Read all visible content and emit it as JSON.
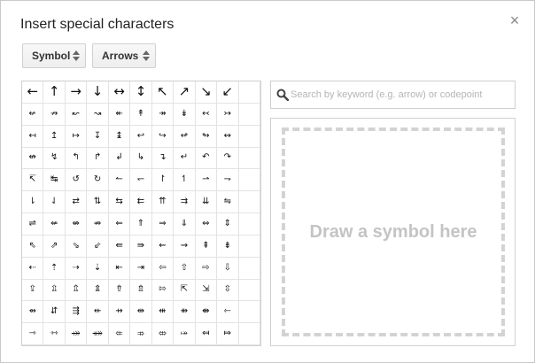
{
  "dialog": {
    "title": "Insert special characters",
    "close_label": "×"
  },
  "selectors": {
    "category": "Symbol",
    "subcategory": "Arrows"
  },
  "search": {
    "placeholder": "Search by keyword (e.g. arrow) or codepoint",
    "value": ""
  },
  "draw": {
    "label": "Draw a symbol here"
  },
  "icons": {
    "close": "close-icon",
    "search": "search-icon",
    "select_arrows": "updown-chevron-icon"
  },
  "grid": {
    "rows": [
      [
        "←",
        "↑",
        "→",
        "↓",
        "↔",
        "↕",
        "↖",
        "↗",
        "↘",
        "↙"
      ],
      [
        "↚",
        "↛",
        "↜",
        "↝",
        "↞",
        "↟",
        "↠",
        "↡",
        "↢",
        "↣"
      ],
      [
        "↤",
        "↥",
        "↦",
        "↧",
        "↨",
        "↩",
        "↪",
        "↫",
        "↬",
        "↭"
      ],
      [
        "↮",
        "↯",
        "↰",
        "↱",
        "↲",
        "↳",
        "↴",
        "↵",
        "↶",
        "↷"
      ],
      [
        "↸",
        "↹",
        "↺",
        "↻",
        "↼",
        "↽",
        "↾",
        "↿",
        "⇀",
        "⇁"
      ],
      [
        "⇂",
        "⇃",
        "⇄",
        "⇅",
        "⇆",
        "⇇",
        "⇈",
        "⇉",
        "⇊",
        "⇋"
      ],
      [
        "⇌",
        "⇍",
        "⇎",
        "⇏",
        "⇐",
        "⇑",
        "⇒",
        "⇓",
        "⇔",
        "⇕"
      ],
      [
        "⇖",
        "⇗",
        "⇘",
        "⇙",
        "⇚",
        "⇛",
        "⇜",
        "⇝",
        "⇞",
        "⇟"
      ],
      [
        "⇠",
        "⇡",
        "⇢",
        "⇣",
        "⇤",
        "⇥",
        "⇦",
        "⇧",
        "⇨",
        "⇩"
      ],
      [
        "⇪",
        "⇫",
        "⇬",
        "⇭",
        "⇮",
        "⇯",
        "⇰",
        "⇱",
        "⇲",
        "⇳"
      ],
      [
        "⇴",
        "⇵",
        "⇶",
        "⇷",
        "⇸",
        "⇹",
        "⇺",
        "⇻",
        "⇼",
        "⇽"
      ],
      [
        "⇾",
        "⇿",
        "⤀",
        "⤁",
        "⤂",
        "⤃",
        "⤄",
        "⤅",
        "⤆",
        "⤇"
      ]
    ]
  }
}
